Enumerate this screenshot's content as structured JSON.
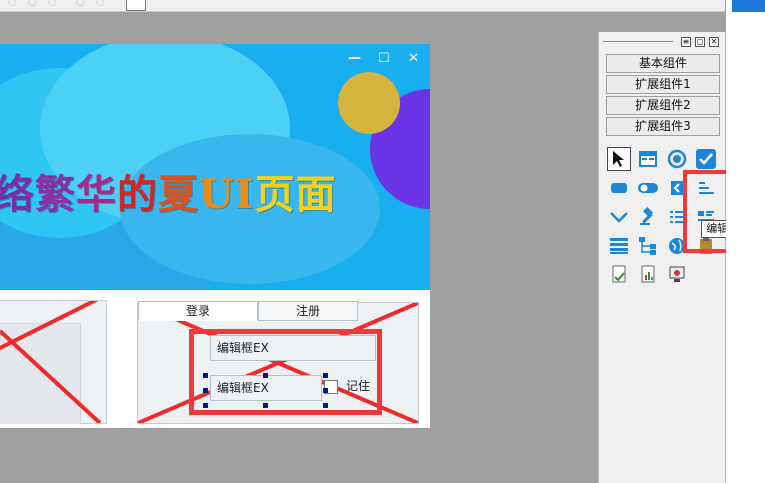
{
  "banner": {
    "title_parts": [
      {
        "text": "络",
        "color": "#7a2ea8"
      },
      {
        "text": "繁",
        "color": "#8a2fa6"
      },
      {
        "text": "华",
        "color": "#a52a8a"
      },
      {
        "text": "的",
        "color": "#d42525"
      },
      {
        "text": "夏",
        "color": "#d9531f"
      },
      {
        "text": " UI",
        "color": "#f08a10"
      },
      {
        "text": "页面",
        "color": "#f2d21a"
      }
    ],
    "window_controls": {
      "minimize": "—",
      "maximize": "☐",
      "close": "✕"
    }
  },
  "form": {
    "tabs": [
      {
        "label": "登录"
      },
      {
        "label": "注册"
      }
    ],
    "edit1_text": "编辑框EX",
    "edit2_text": "编辑框EX",
    "remember_label": "记住"
  },
  "toolbox": {
    "header_buttons": [
      "≡",
      "◻",
      "✕"
    ],
    "categories": [
      {
        "label": "基本组件"
      },
      {
        "label": "扩展组件1"
      },
      {
        "label": "扩展组件2"
      },
      {
        "label": "扩展组件3"
      }
    ],
    "tooltip": "编辑框EX"
  },
  "colors": {
    "highlight_red": "#f03a3a",
    "banner_blue": "#19aef0",
    "icon_blue": "#1c86d8"
  }
}
